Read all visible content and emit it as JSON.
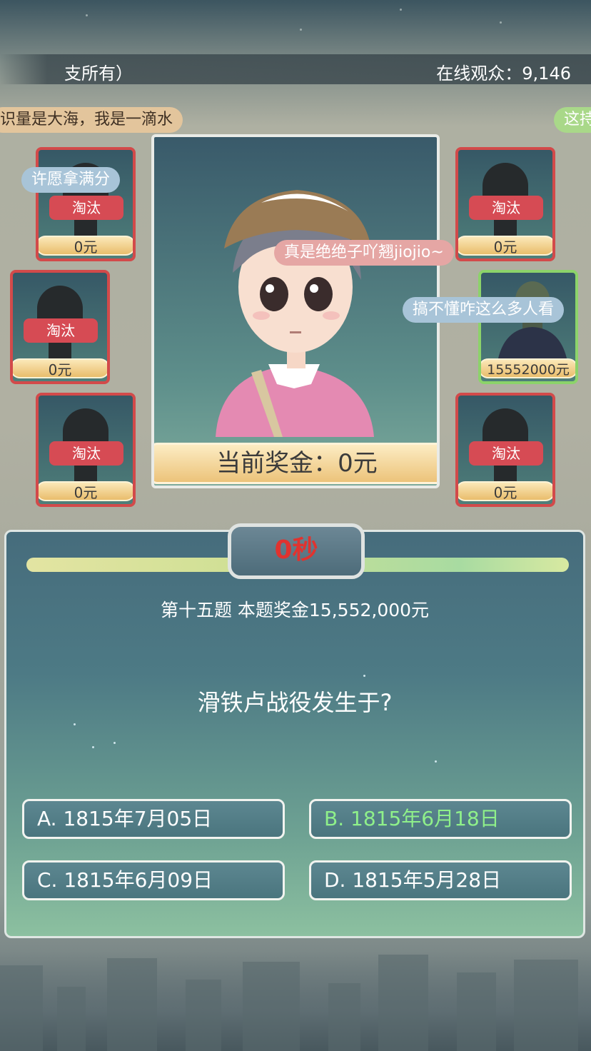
{
  "top_bar": {
    "left_text": "支所有）",
    "viewers_label": "在线观众：",
    "viewers_count": "9,146"
  },
  "danmaku": [
    "识量是大海，我是一滴水",
    "这持",
    "许愿拿满分",
    "真是绝绝子吖翘jiojio~",
    "搞不懂咋这么多人看"
  ],
  "players_left": [
    {
      "status": "淘汰",
      "money": "0元"
    },
    {
      "status": "淘汰",
      "money": "0元"
    },
    {
      "status": "淘汰",
      "money": "0元"
    }
  ],
  "players_right": [
    {
      "status": "淘汰",
      "money": "0元"
    },
    {
      "status": "",
      "money": "15552000元"
    },
    {
      "status": "淘汰",
      "money": "0元"
    }
  ],
  "current_prize": "当前奖金：0元",
  "timer": "0秒",
  "question": {
    "meta": "第十五题 本题奖金15,552,000元",
    "text": "滑铁卢战役发生于?",
    "options": [
      {
        "label": "A. 1815年7月05日",
        "correct": false
      },
      {
        "label": "B. 1815年6月18日",
        "correct": true
      },
      {
        "label": "C. 1815年6月09日",
        "correct": false
      },
      {
        "label": "D. 1815年5月28日",
        "correct": false
      }
    ]
  },
  "colors": {
    "elim_red": "#d64b54",
    "correct_green": "#8ff08a",
    "timer_red": "#e0332f"
  }
}
